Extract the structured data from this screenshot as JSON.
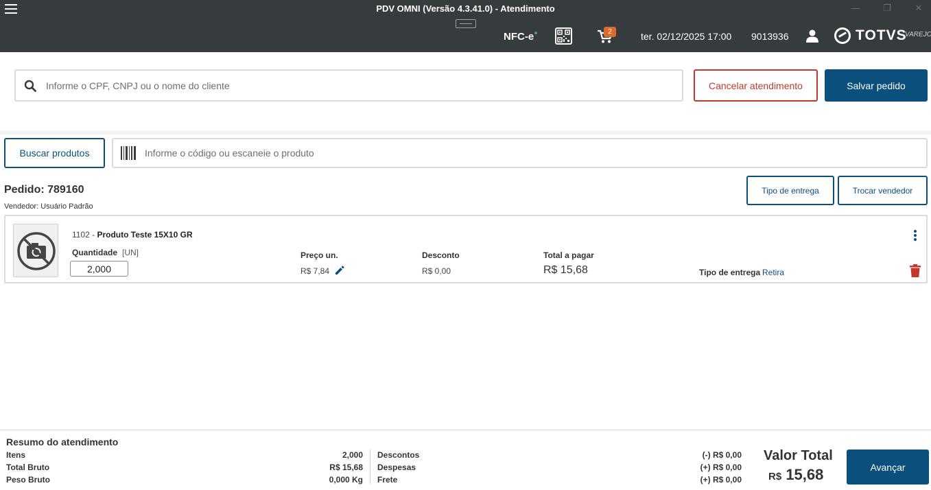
{
  "titlebar": {
    "title": "PDV OMNI (Versão 4.3.41.0) - Atendimento",
    "minimize_icon": "minimize-icon",
    "maximize_icon": "restore-icon",
    "close_icon": "close-icon",
    "fiscal_mode": "NFC-e",
    "cart_count": "2",
    "datetime": "ter. 02/12/2025 17:00",
    "station_id": "9013936",
    "brand": "TOTVS",
    "brand_sub": "VAREJO"
  },
  "client": {
    "search_placeholder": "Informe o CPF, CNPJ ou o nome do cliente",
    "search_value": "",
    "cancel_label": "Cancelar atendimento",
    "save_label": "Salvar pedido"
  },
  "product_search": {
    "button_label": "Buscar produtos",
    "code_placeholder": "Informe o código ou escaneie o produto",
    "code_value": ""
  },
  "order": {
    "title": "Pedido: 789160",
    "seller": "Vendedor: Usuário Padrão",
    "delivery_button": "Tipo de entrega",
    "seller_button": "Trocar vendedor"
  },
  "items": [
    {
      "code": "1102 - ",
      "name": "Produto Teste 15X10 GR",
      "qty_label": "Quantidade",
      "unit": "[UN]",
      "qty": "2,000",
      "price_label": "Preço un.",
      "price": "R$ 7,84",
      "discount_label": "Desconto",
      "discount": "R$ 0,00",
      "total_label": "Total a pagar",
      "total": "R$ 15,68",
      "delivery_label": "Tipo de entrega",
      "delivery": "Retira"
    }
  ],
  "summary": {
    "title": "Resumo do atendimento",
    "left": [
      {
        "label": "Itens",
        "value": "2,000"
      },
      {
        "label": "Total Bruto",
        "value": "R$ 15,68"
      },
      {
        "label": "Peso Bruto",
        "value": "0,000 Kg"
      }
    ],
    "right": [
      {
        "label": "Descontos",
        "value": "(-) R$ 0,00"
      },
      {
        "label": "Despesas",
        "value": "(+) R$ 0,00"
      },
      {
        "label": "Frete",
        "value": "(+) R$ 0,00"
      }
    ],
    "total_label": "Valor Total",
    "total_currency": "R$",
    "total_value": "15,68",
    "next_label": "Avançar"
  },
  "colors": {
    "titlebar_bg": "#363b3e",
    "primary": "#0b4f7d",
    "danger": "#c0392b",
    "badge": "#d96b2c"
  }
}
